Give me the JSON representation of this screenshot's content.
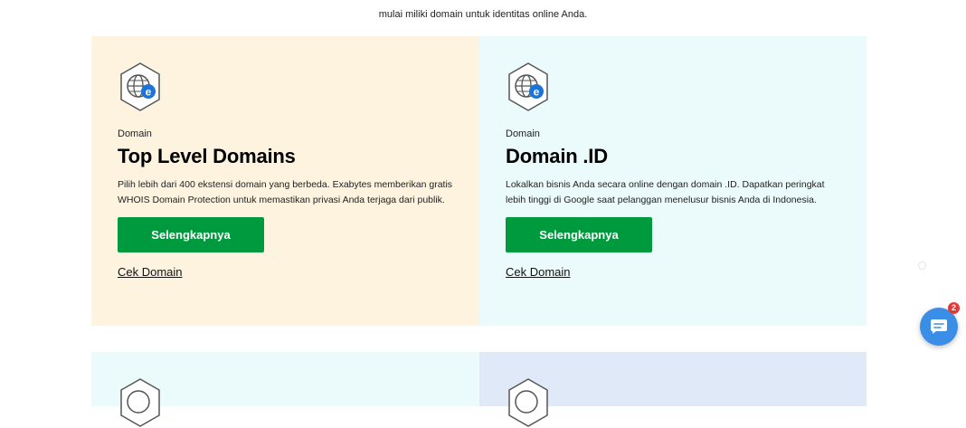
{
  "intro": {
    "text": "mulai miliki domain untuk identitas online Anda."
  },
  "cards": [
    {
      "eyebrow": "Domain",
      "title": "Top Level Domains",
      "description": "Pilih lebih dari 400 ekstensi domain yang berbeda. Exabytes memberikan gratis WHOIS Domain Protection untuk memastikan privasi Anda terjaga dari publik.",
      "button_label": "Selengkapnya",
      "link_label": "Cek Domain",
      "icon": "domain-globe-icon",
      "bg": "#fdf3df"
    },
    {
      "eyebrow": "Domain",
      "title": "Domain .ID",
      "description": "Lokalkan bisnis Anda secara online dengan domain .ID. Dapatkan peringkat lebih tinggi di Google saat pelanggan menelusur bisnis Anda di Indonesia.",
      "button_label": "Selengkapnya",
      "link_label": "Cek Domain",
      "icon": "domain-globe-icon",
      "bg": "#ebfafb"
    }
  ],
  "chat": {
    "badge_count": "2",
    "icon": "chat-icon"
  },
  "colors": {
    "button": "#009a3e",
    "chat": "#3a8ee6",
    "badge": "#e53935",
    "icon_accent": "#1e73d8"
  }
}
